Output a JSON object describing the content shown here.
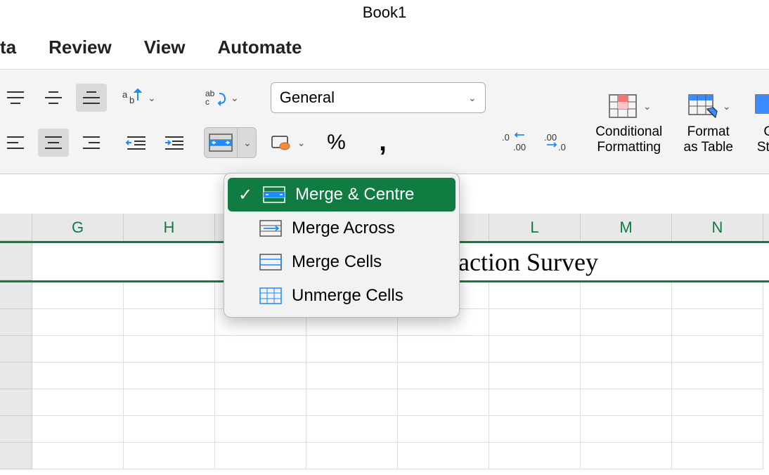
{
  "title": "Book1",
  "tabs": {
    "data": "ta",
    "review": "Review",
    "view": "View",
    "automate": "Automate"
  },
  "number_format": {
    "selected": "General"
  },
  "styles_group": {
    "cond_fmt": "Conditional\nFormatting",
    "fmt_table": "Format\nas Table",
    "cell_styles": "Cell\nStyles"
  },
  "merge_menu": {
    "merge_centre": "Merge & Centre",
    "merge_across": "Merge Across",
    "merge_cells": "Merge Cells",
    "unmerge": "Unmerge Cells"
  },
  "columns": {
    "G": "G",
    "H": "H",
    "L": "L",
    "M": "M",
    "N": "N"
  },
  "cell_content": {
    "a1_partial": "faction Survey"
  }
}
